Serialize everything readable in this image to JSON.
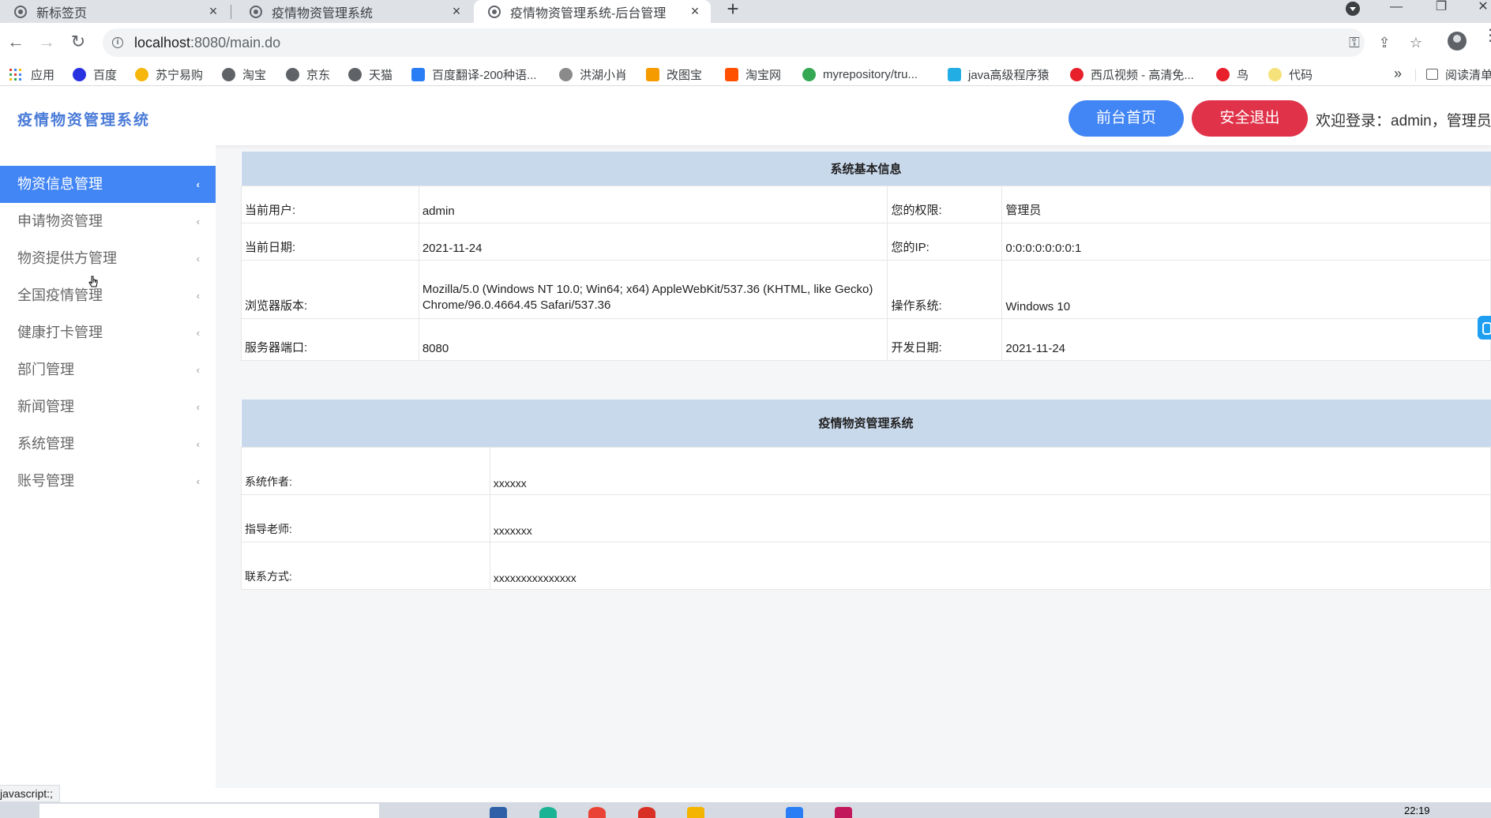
{
  "browser": {
    "tabs": [
      {
        "title": "新标签页",
        "active": false
      },
      {
        "title": "疫情物资管理系统",
        "active": false
      },
      {
        "title": "疫情物资管理系统-后台管理",
        "active": true
      }
    ],
    "tab_close_glyph": "×",
    "new_tab_glyph": "+",
    "url_host": "localhost",
    "url_rest": ":8080/main.do",
    "bookmarks": [
      {
        "label": "应用",
        "icon": "apps-grid-icon",
        "color": "#4285f4"
      },
      {
        "label": "百度",
        "icon": "baidu-paw-icon",
        "color": "#2932e1"
      },
      {
        "label": "苏宁易购",
        "icon": "suning-icon",
        "color": "#f6b60b"
      },
      {
        "label": "淘宝",
        "icon": "globe-icon",
        "color": "#5f6368"
      },
      {
        "label": "京东",
        "icon": "globe-icon",
        "color": "#5f6368"
      },
      {
        "label": "天猫",
        "icon": "globe-icon",
        "color": "#5f6368"
      },
      {
        "label": "百度翻译-200种语...",
        "icon": "translate-icon",
        "color": "#2a7ef5"
      },
      {
        "label": "洪湖小肖",
        "icon": "bird-icon",
        "color": "#8a8a8a"
      },
      {
        "label": "改图宝",
        "icon": "folder-icon",
        "color": "#f59b00"
      },
      {
        "label": "淘宝网",
        "icon": "taobao-icon",
        "color": "#ff5000"
      },
      {
        "label": "myrepository/tru...",
        "icon": "chrome-icon",
        "color": "#34a853"
      },
      {
        "label": "java高级程序猿",
        "icon": "bilibili-icon",
        "color": "#23ade5"
      },
      {
        "label": "西瓜视频 - 高清免...",
        "icon": "xigua-icon",
        "color": "#e8202c"
      },
      {
        "label": "鸟",
        "icon": "bird-red-icon",
        "color": "#e8202c"
      },
      {
        "label": "代码",
        "icon": "code-bookmark-icon",
        "color": "#f6e27a"
      }
    ],
    "bookmarks_overflow": "»",
    "reading_list": "阅读清单",
    "status_text": "javascript:;"
  },
  "app": {
    "logo": "疫情物资管理系统",
    "home_button": "前台首页",
    "logout_button": "安全退出",
    "welcome": "欢迎登录：admin，管理员",
    "colors": {
      "primary": "#4285f4",
      "danger": "#e0334a",
      "header_bg": "#c9d9ec"
    },
    "sidebar": [
      {
        "label": "物资信息管理",
        "active": true
      },
      {
        "label": "申请物资管理",
        "active": false
      },
      {
        "label": "物资提供方管理",
        "active": false
      },
      {
        "label": "全国疫情管理",
        "active": false
      },
      {
        "label": "健康打卡管理",
        "active": false
      },
      {
        "label": "部门管理",
        "active": false
      },
      {
        "label": "新闻管理",
        "active": false
      },
      {
        "label": "系统管理",
        "active": false
      },
      {
        "label": "账号管理",
        "active": false
      }
    ],
    "chevron_glyph": "‹",
    "system_info": {
      "title": "系统基本信息",
      "current_user_label": "当前用户:",
      "current_user": "admin",
      "permission_label": "您的权限:",
      "permission": "管理员",
      "date_label": "当前日期:",
      "date": "2021-11-24",
      "ip_label": "您的IP:",
      "ip": "0:0:0:0:0:0:0:1",
      "browser_label": "浏览器版本:",
      "browser": "Mozilla/5.0 (Windows NT 10.0; Win64; x64) AppleWebKit/537.36 (KHTML, like Gecko) Chrome/96.0.4664.45 Safari/537.36",
      "os_label": "操作系统:",
      "os": "Windows 10",
      "port_label": "服务器端口:",
      "port": "8080",
      "dev_date_label": "开发日期:",
      "dev_date": "2021-11-24"
    },
    "about": {
      "title": "疫情物资管理系统",
      "author_label": "系统作者:",
      "author": "xxxxxx",
      "teacher_label": "指导老师:",
      "teacher": "xxxxxxx",
      "contact_label": "联系方式:",
      "contact": "xxxxxxxxxxxxxxx"
    }
  },
  "taskbar": {
    "clock": "22:19"
  }
}
